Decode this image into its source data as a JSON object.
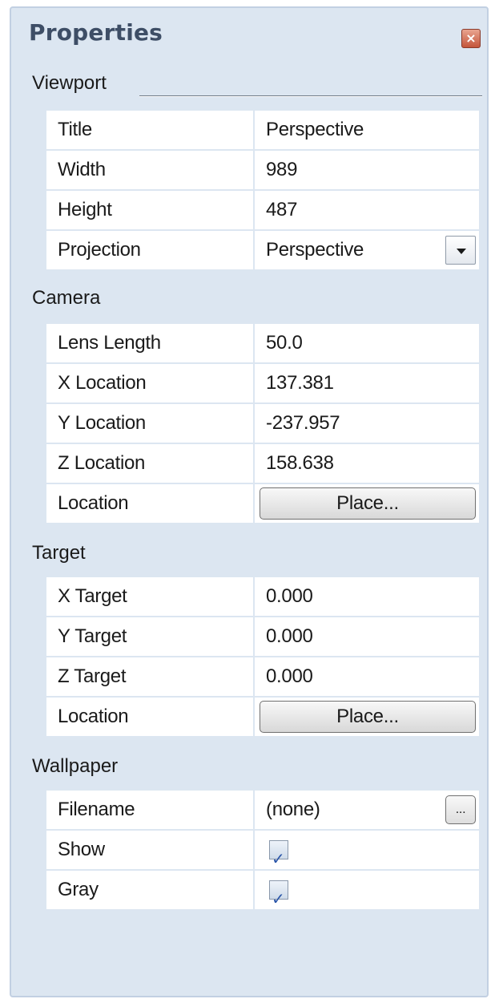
{
  "panel": {
    "title": "Properties",
    "close_icon": "close-icon"
  },
  "viewport": {
    "label": "Viewport",
    "rows": [
      {
        "name": "Title",
        "value": "Perspective"
      },
      {
        "name": "Width",
        "value": "989"
      },
      {
        "name": "Height",
        "value": "487"
      },
      {
        "name": "Projection",
        "value": "Perspective"
      }
    ]
  },
  "camera": {
    "label": "Camera",
    "rows": [
      {
        "name": "Lens Length",
        "value": "50.0"
      },
      {
        "name": "X Location",
        "value": "137.381"
      },
      {
        "name": "Y Location",
        "value": "-237.957"
      },
      {
        "name": "Z Location",
        "value": "158.638"
      },
      {
        "name": "Location",
        "button": "Place..."
      }
    ]
  },
  "target": {
    "label": "Target",
    "rows": [
      {
        "name": "X Target",
        "value": "0.000"
      },
      {
        "name": "Y Target",
        "value": "0.000"
      },
      {
        "name": "Z Target",
        "value": "0.000"
      },
      {
        "name": "Location",
        "button": "Place..."
      }
    ]
  },
  "wallpaper": {
    "label": "Wallpaper",
    "rows": [
      {
        "name": "Filename",
        "value": "(none)",
        "button": "..."
      },
      {
        "name": "Show",
        "checked": true
      },
      {
        "name": "Gray",
        "checked": true
      }
    ]
  },
  "colors": {
    "panel_bg": "#dce6f1",
    "title_color": "#3e4e66",
    "close_button": "#c4553b",
    "check_color": "#2a55a8"
  }
}
